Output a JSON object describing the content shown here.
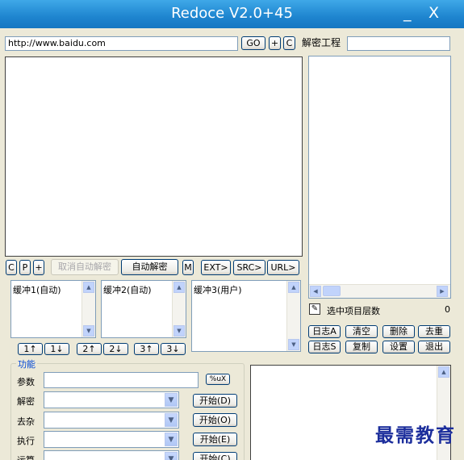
{
  "window": {
    "title": "Redoce V2.0+45",
    "minimize": "_",
    "close": "X"
  },
  "url": {
    "value": "http://www.baidu.com",
    "go": "GO",
    "plus": "+",
    "c": "C"
  },
  "decrypt_project": {
    "label": "解密工程",
    "value": ""
  },
  "toolbar": {
    "c": "C",
    "p": "P",
    "plus": "+",
    "cancel_auto": "取消自动解密",
    "auto": "自动解密",
    "m": "M",
    "ext": "EXT>",
    "src": "SRC>",
    "url": "URL>"
  },
  "buffers": {
    "b1": "缓冲1(自动)",
    "b2": "缓冲2(自动)",
    "b3": "缓冲3(用户)"
  },
  "buffer_buttons": {
    "b1_up": "1↑",
    "b1_down": "1↓",
    "b2_up": "2↑",
    "b2_down": "2↓",
    "b3_up": "3↑",
    "b3_down": "3↓"
  },
  "tree": {
    "selected_label": "选中项目层数",
    "selected_count": "0"
  },
  "log_buttons": {
    "log_a": "日志A",
    "clear": "清空",
    "delete": "删除",
    "dedupe": "去重",
    "log_s": "日志S",
    "copy": "复制",
    "settings": "设置",
    "exit": "退出"
  },
  "functions": {
    "group_label": "功能",
    "param_label": "参数",
    "percent_u": "%uX",
    "decrypt_label": "解密",
    "decrypt_start": "开始(D)",
    "clean_label": "去杂",
    "clean_start": "开始(O)",
    "exec_label": "执行",
    "exec_start": "开始(E)",
    "calc_label": "运算",
    "calc_start": "开始(C)"
  },
  "watermark": "最需教育",
  "icons": {
    "scroll_up": "▲",
    "scroll_down": "▼",
    "scroll_left": "◀",
    "scroll_right": "▶",
    "combo_arrow": "▼",
    "edit": "✎"
  }
}
